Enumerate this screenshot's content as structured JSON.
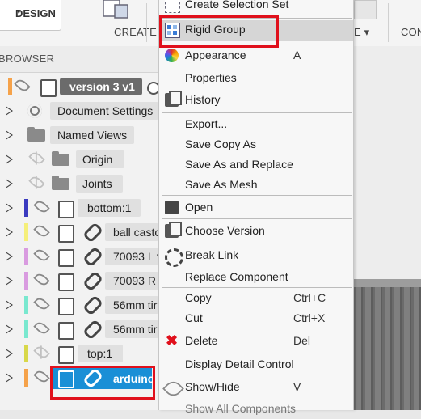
{
  "toolbar": {
    "design_label": "DESIGN",
    "design_caret": "▾",
    "create_label": "CREATE",
    "cut_label": "E ▾",
    "con_label": "CON"
  },
  "browser": {
    "title": "BROWSER",
    "root": {
      "label": "version 3 v1"
    },
    "items": [
      {
        "label": "Document Settings"
      },
      {
        "label": "Named Views"
      },
      {
        "label": "Origin"
      },
      {
        "label": "Joints"
      },
      {
        "label": "bottom:1"
      },
      {
        "label": "ball casto"
      },
      {
        "label": "70093 L v"
      },
      {
        "label": "70093 R"
      },
      {
        "label": "56mm tire"
      },
      {
        "label": "56mm tire"
      },
      {
        "label": "top:1"
      },
      {
        "label": "arduino"
      }
    ],
    "colors": {
      "selected": "#1a8fd6",
      "bar_bottom": "#3a3abf",
      "bar_ball": "#f5ef7a",
      "bar_70093": "#d99be0",
      "bar_56mm": "#79e8cf",
      "bar_top": "#d8d84a",
      "bar_arduino": "#f5a24a",
      "bar_root": "#f5a24a"
    }
  },
  "menu": {
    "create_selection_set": "Create Selection Set",
    "rigid_group": "Rigid Group",
    "appearance": "Appearance",
    "appearance_key": "A",
    "properties": "Properties",
    "history": "History",
    "export": "Export...",
    "save_copy_as": "Save Copy As",
    "save_as_replace": "Save As and Replace",
    "save_as_mesh": "Save As Mesh",
    "open": "Open",
    "choose_version": "Choose Version",
    "break_link": "Break Link",
    "replace_component": "Replace Component",
    "copy": "Copy",
    "copy_key": "Ctrl+C",
    "cut": "Cut",
    "cut_key": "Ctrl+X",
    "delete": "Delete",
    "delete_key": "Del",
    "display_detail_control": "Display Detail Control",
    "show_hide": "Show/Hide",
    "show_hide_key": "V",
    "show_all_components": "Show All Components"
  }
}
